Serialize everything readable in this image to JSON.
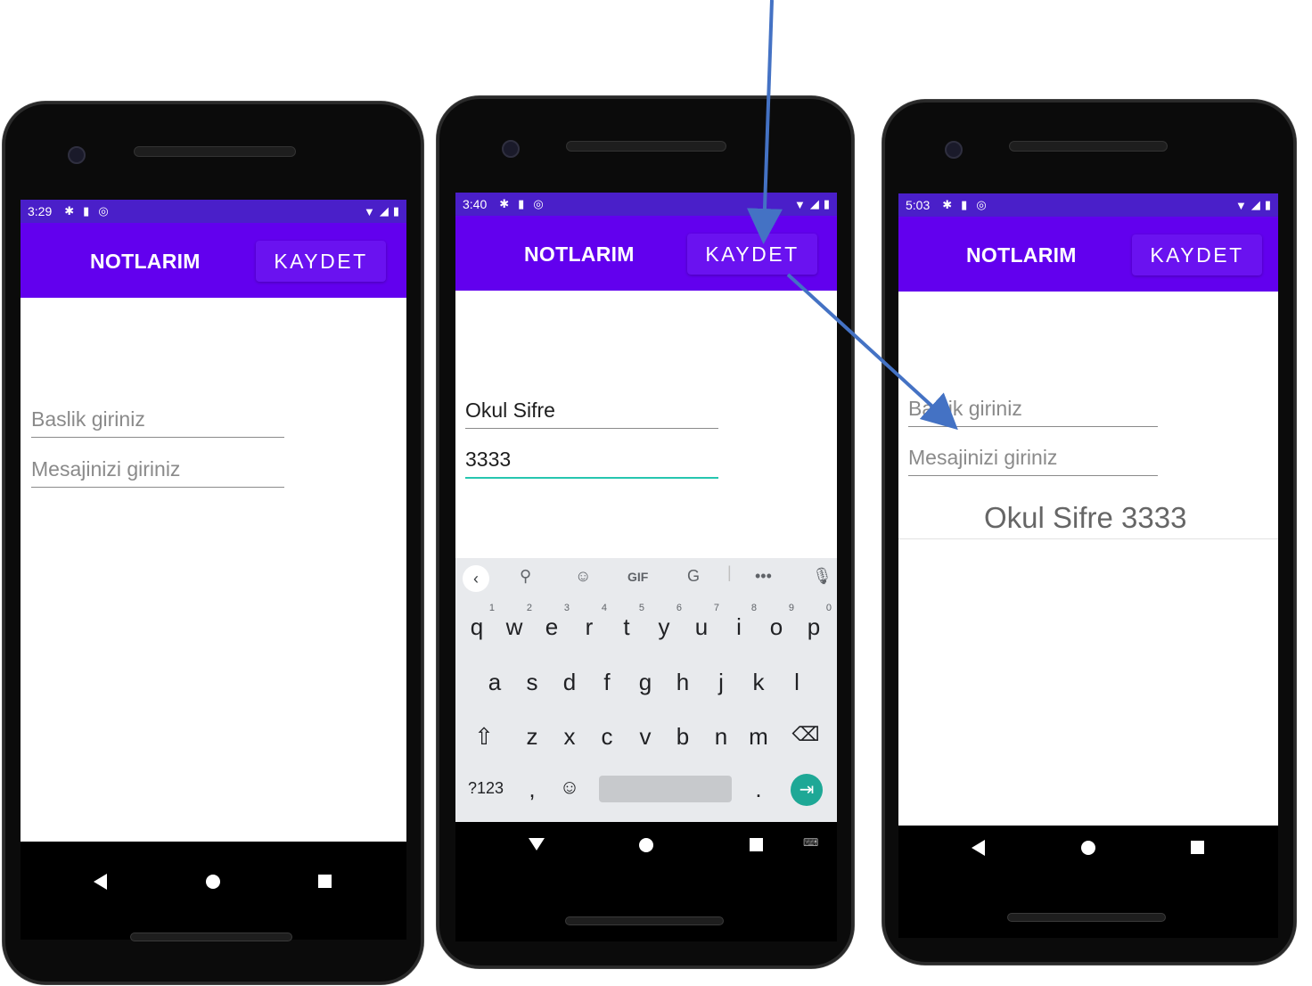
{
  "status_icons": [
    "gear-icon",
    "sd-card-icon",
    "sync-icon"
  ],
  "status_right": [
    "wifi-icon",
    "signal-icon",
    "battery-icon"
  ],
  "phones": [
    {
      "time": "3:29",
      "app_title": "NOTLARIM",
      "save_label": "KAYDET",
      "title_hint": "Baslik giriniz",
      "message_hint": "Mesajinizi giriniz"
    },
    {
      "time": "3:40",
      "app_title": "NOTLARIM",
      "save_label": "KAYDET",
      "title_value": "Okul Sifre",
      "message_value": "3333",
      "keyboard": {
        "gif_label": "GIF",
        "row1": [
          "q",
          "w",
          "e",
          "r",
          "t",
          "y",
          "u",
          "i",
          "o",
          "p"
        ],
        "row1_digits": [
          "1",
          "2",
          "3",
          "4",
          "5",
          "6",
          "7",
          "8",
          "9",
          "0"
        ],
        "row2": [
          "a",
          "s",
          "d",
          "f",
          "g",
          "h",
          "j",
          "k",
          "l"
        ],
        "row3": [
          "z",
          "x",
          "c",
          "v",
          "b",
          "n",
          "m"
        ],
        "symbols_label": "?123",
        "comma": ",",
        "period": "."
      }
    },
    {
      "time": "5:03",
      "app_title": "NOTLARIM",
      "save_label": "KAYDET",
      "title_hint": "Baslik giriniz",
      "message_hint": "Mesajinizi giriniz",
      "saved_note": "Okul Sifre 3333"
    }
  ],
  "colors": {
    "status_bar": "#4a1fc9",
    "app_bar": "#6200ee",
    "focus_underline": "#26c6b0",
    "enter_key": "#1ea896",
    "arrow": "#4472c4"
  }
}
